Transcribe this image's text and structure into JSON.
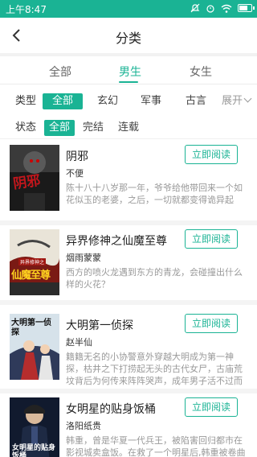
{
  "status_bar": {
    "time": "上午8:47",
    "battery_level": 0.8
  },
  "header": {
    "title": "分类"
  },
  "gender_tabs": [
    {
      "label": "全部",
      "active": false
    },
    {
      "label": "男生",
      "active": true
    },
    {
      "label": "女生",
      "active": false
    }
  ],
  "type_filter": {
    "label": "类型",
    "options": [
      "全部",
      "玄幻",
      "军事",
      "古言"
    ],
    "selected": "全部",
    "expand_label": "展开"
  },
  "status_filter": {
    "label": "状态",
    "options": [
      "全部",
      "完结",
      "连载"
    ],
    "selected": "全部"
  },
  "read_button_label": "立即阅读",
  "books": [
    {
      "title": "阴邪",
      "author": "不便",
      "desc": "陈十八十八岁那一年，爷爷给他带回来一个如花似玉的老婆，之后，一切就都变得诡异起来.....",
      "cover_text": "阴邪"
    },
    {
      "title": "异界修神之仙魔至尊",
      "author": "烟雨蒙蒙",
      "desc": "西方的喷火龙遇到东方的青龙，会碰撞出什么样的火花？",
      "cover_text": "仙魔至尊",
      "cover_subtext": "异界修神之"
    },
    {
      "title": "大明第一侦探",
      "author": "赵半仙",
      "desc": "籍籍无名的小协警意外穿越大明成为第一神探，枯井之下打捞起无头的古代女尸，古庙荒坟背后为何传来阵阵哭声，成年男子活不过而立之年的寡妇......",
      "cover_text": "大明第一侦探"
    },
    {
      "title": "女明星的贴身饭桶",
      "author": "洛阳纸贵",
      "desc": "韩重，曾是华夏一代兵王，被陷害回归都市在影视城卖盒饭。在救了一个明星后,韩重被卷曲一场又一场风波，从此他走上了巅峰之路......",
      "cover_text": "女明星的贴身饭桶"
    }
  ],
  "colors": {
    "accent": "#1ab394"
  }
}
